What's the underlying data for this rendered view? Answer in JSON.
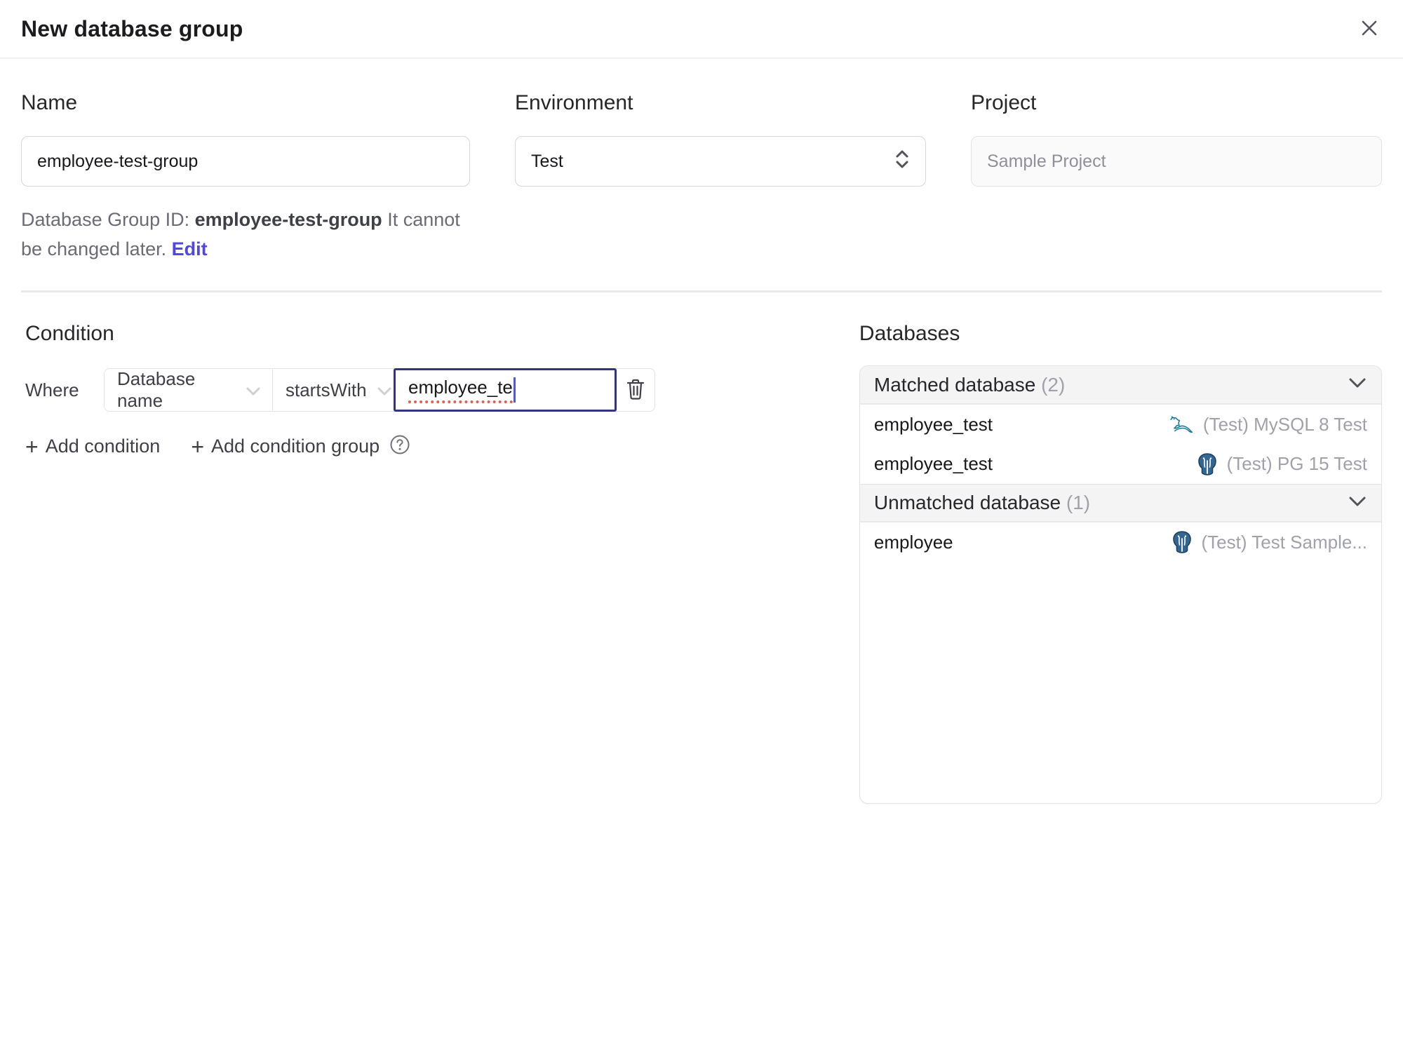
{
  "dialog": {
    "title": "New database group"
  },
  "form": {
    "name": {
      "label": "Name",
      "value": "employee-test-group"
    },
    "environment": {
      "label": "Environment",
      "value": "Test"
    },
    "project": {
      "label": "Project",
      "value": "Sample Project"
    },
    "id_hint": {
      "prefix": "Database Group ID: ",
      "id": "employee-test-group",
      "suffix": " It cannot be changed later. ",
      "edit_label": "Edit"
    }
  },
  "condition": {
    "heading": "Condition",
    "where_label": "Where",
    "factor": "Database name",
    "operator": "startsWith",
    "value": "employee_te",
    "add_condition_label": "Add condition",
    "add_condition_group_label": "Add condition group",
    "plus": "+"
  },
  "databases": {
    "heading": "Databases",
    "matched": {
      "label": "Matched database",
      "count": "(2)",
      "rows": [
        {
          "name": "employee_test",
          "instance": "(Test) MySQL 8 Test",
          "engine": "mysql"
        },
        {
          "name": "employee_test",
          "instance": "(Test) PG 15 Test",
          "engine": "postgres"
        }
      ]
    },
    "unmatched": {
      "label": "Unmatched database",
      "count": "(1)",
      "rows": [
        {
          "name": "employee",
          "instance": "(Test) Test Sample...",
          "engine": "postgres"
        }
      ]
    }
  },
  "colors": {
    "accent": "#4f46e5",
    "focus_border": "#34347e",
    "spellcheck_red": "#e0604e",
    "mysql_teal": "#1d7a99",
    "postgres_blue": "#336791",
    "muted_text": "#a1a1aa"
  }
}
